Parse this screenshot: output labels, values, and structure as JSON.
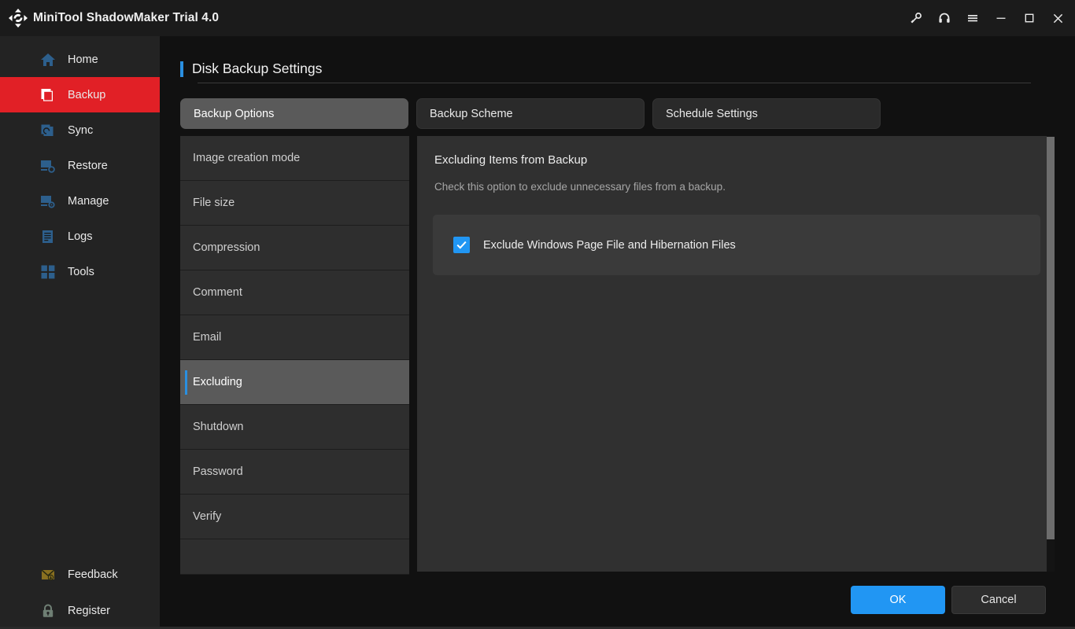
{
  "titlebar": {
    "logo_icon": "refresh-circular-arrows-icon",
    "app_title": "MiniTool ShadowMaker Trial 4.0",
    "actions": [
      {
        "name": "key-icon",
        "label": "Key"
      },
      {
        "name": "headset-icon",
        "label": "Support"
      },
      {
        "name": "hamburger-menu-icon",
        "label": "Menu"
      }
    ],
    "window_controls": [
      {
        "name": "minimize-icon",
        "label": "Minimize"
      },
      {
        "name": "maximize-icon",
        "label": "Maximize"
      },
      {
        "name": "close-icon",
        "label": "Close"
      }
    ]
  },
  "sidebar": {
    "items": [
      {
        "label": "Home",
        "icon": "home-icon",
        "active": false
      },
      {
        "label": "Backup",
        "icon": "backup-icon",
        "active": true
      },
      {
        "label": "Sync",
        "icon": "sync-icon",
        "active": false
      },
      {
        "label": "Restore",
        "icon": "restore-icon",
        "active": false
      },
      {
        "label": "Manage",
        "icon": "manage-icon",
        "active": false
      },
      {
        "label": "Logs",
        "icon": "logs-icon",
        "active": false
      },
      {
        "label": "Tools",
        "icon": "tools-icon",
        "active": false
      }
    ],
    "bottom_items": [
      {
        "label": "Feedback",
        "icon": "envelope-icon"
      },
      {
        "label": "Register",
        "icon": "lock-icon"
      }
    ],
    "active_color": "#e12026",
    "icon_color": "#2d5f8c"
  },
  "main": {
    "page_title": "Disk Backup Settings",
    "accent_color": "#2a8fe0",
    "tabs": [
      {
        "label": "Backup Options",
        "active": true
      },
      {
        "label": "Backup Scheme",
        "active": false
      },
      {
        "label": "Schedule Settings",
        "active": false
      }
    ],
    "options": [
      {
        "label": "Image creation mode",
        "selected": false
      },
      {
        "label": "File size",
        "selected": false
      },
      {
        "label": "Compression",
        "selected": false
      },
      {
        "label": "Comment",
        "selected": false
      },
      {
        "label": "Email",
        "selected": false
      },
      {
        "label": "Excluding",
        "selected": true
      },
      {
        "label": "Shutdown",
        "selected": false
      },
      {
        "label": "Password",
        "selected": false
      },
      {
        "label": "Verify",
        "selected": false
      }
    ],
    "detail": {
      "heading": "Excluding Items from Backup",
      "description": "Check this option to exclude unnecessary files from a backup.",
      "checkbox": {
        "label": "Exclude Windows Page File and Hibernation Files",
        "checked": true,
        "color": "#2196f3"
      }
    },
    "footer": {
      "ok_label": "OK",
      "cancel_label": "Cancel",
      "ok_color": "#2196f3"
    }
  }
}
